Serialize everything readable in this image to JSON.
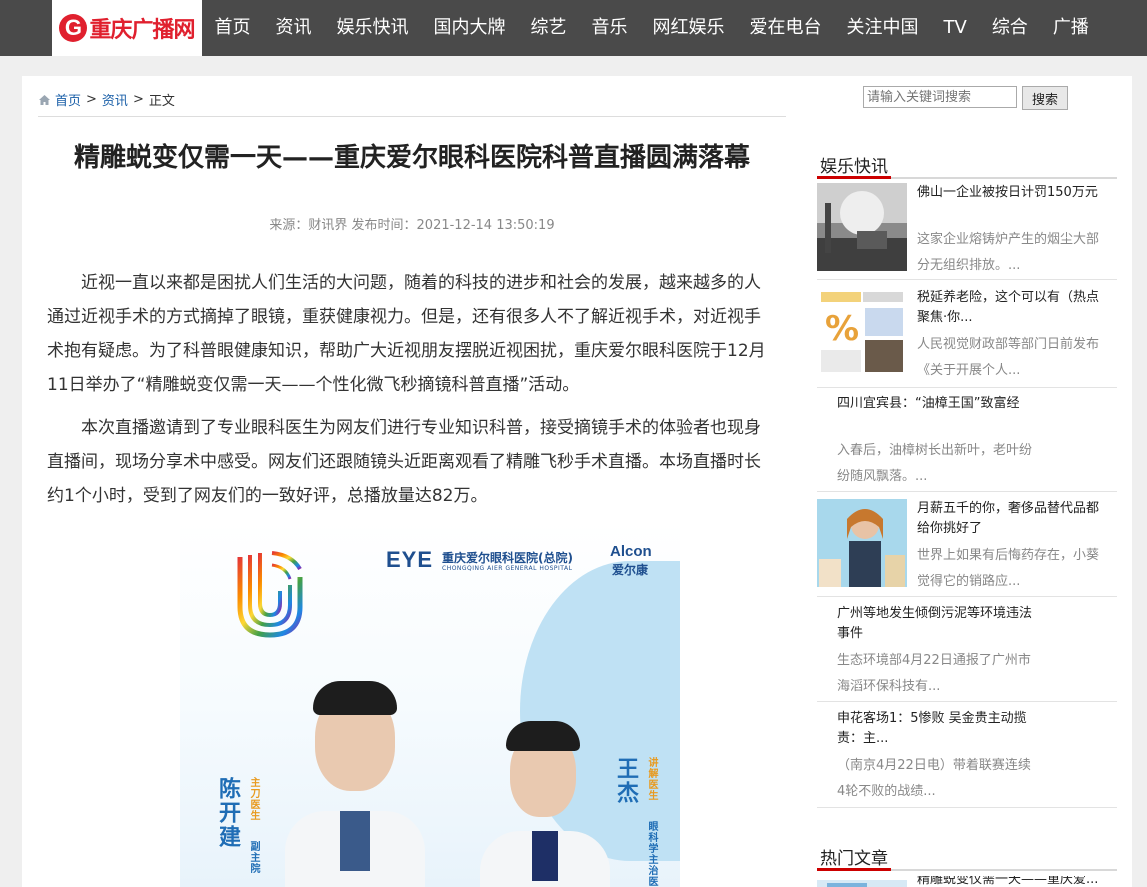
{
  "site": {
    "logo_letter": "G",
    "logo_text": "重庆广播网"
  },
  "nav": [
    "首页",
    "资讯",
    "娱乐快讯",
    "国内大牌",
    "综艺",
    "音乐",
    "网红娱乐",
    "爱在电台",
    "关注中国",
    "TV",
    "综合",
    "广播"
  ],
  "breadcrumb": {
    "home": "首页",
    "section": "资讯",
    "sep": ">",
    "current": "正文"
  },
  "article": {
    "title": "精雕蜕变仅需一天——重庆爱尔眼科医院科普直播圆满落幕",
    "meta": "来源：财讯界  发布时间：2021-12-14 13:50:19",
    "paragraphs": [
      "近视一直以来都是困扰人们生活的大问题，随着的科技的进步和社会的发展，越来越多的人通过近视手术的方式摘掉了眼镜，重获健康视力。但是，还有很多人不了解近视手术，对近视手术抱有疑虑。为了科普眼健康知识，帮助广大近视朋友摆脱近视困扰，重庆爱尔眼科医院于12月11日举办了“精雕蜕变仅需一天——个性化微飞秒摘镜科普直播”活动。",
      "本次直播邀请到了专业眼科医生为网友们进行专业知识科普，接受摘镜手术的体验者也现身直播间，现场分享术中感受。网友们还跟随镜头近距离观看了精雕飞秒手术直播。本场直播时长约1个小时，受到了网友们的一致好评，总播放量达82万。"
    ],
    "poster": {
      "eye_logo": "EYE",
      "hospital_name": "重庆爱尔眼科医院(总院)",
      "hospital_sub": "CHONGQING AIER GENERAL HOSPITAL",
      "alcon": "Alcon",
      "alcon_cn": "爱尔康",
      "doctor1_name": "陈开建",
      "doctor1_role": "主刀医生",
      "doctor1_title": "副主院",
      "doctor2_name": "王杰",
      "doctor2_role": "讲解医生",
      "doctor2_title": "眼科学主治医"
    }
  },
  "search": {
    "placeholder": "请输入关键词搜索",
    "button": "搜索"
  },
  "sidebar": {
    "section1": "娱乐快讯",
    "section2": "热门文章",
    "news": [
      {
        "title": "佛山一企业被按日计罚150万元",
        "desc": "这家企业熔铸炉产生的烟尘大部分无组织排放。..."
      },
      {
        "title": "税延养老险，这个可以有（热点聚焦·你...",
        "desc": "人民视觉财政部等部门日前发布《关于开展个人..."
      },
      {
        "title": "四川宜宾县：“油樟王国”致富经",
        "desc": "入春后，油樟树长出新叶，老叶纷纷随风飘落。..."
      },
      {
        "title": "月薪五千的你，奢侈品替代品都给你挑好了",
        "desc": "世界上如果有后悔药存在，小葵觉得它的销路应..."
      },
      {
        "title": "广州等地发生倾倒污泥等环境违法事件",
        "desc": "生态环境部4月22日通报了广州市海滔环保科技有..."
      },
      {
        "title": "申花客场1：5惨败 吴金贵主动揽责：主...",
        "desc": "（南京4月22日电）带着联赛连续4轮不败的战绩..."
      }
    ],
    "hot": [
      {
        "title": "精雕蜕变仅需一天——重庆爱..."
      }
    ]
  }
}
